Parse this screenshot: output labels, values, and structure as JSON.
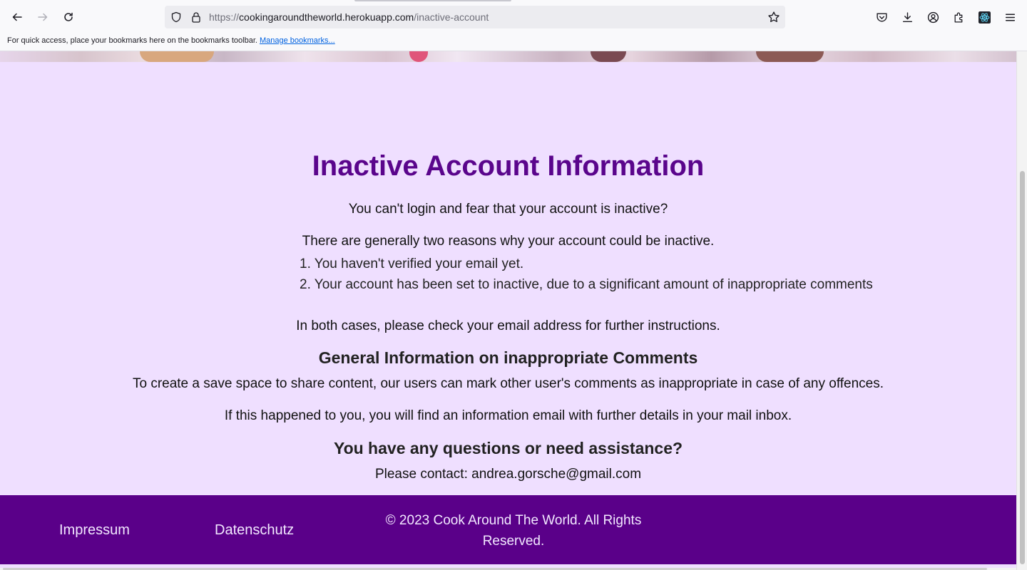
{
  "browser": {
    "url_scheme": "https://",
    "url_host": "cookingaroundtheworld.herokuapp.com",
    "url_path": "/inactive-account",
    "bookmarks_hint": "For quick access, place your bookmarks here on the bookmarks toolbar.",
    "manage_bookmarks": "Manage bookmarks..."
  },
  "page": {
    "title": "Inactive Account Information",
    "intro": "You can't login and fear that your account is inactive?",
    "reasons_intro": "There are generally two reasons why your account could be inactive.",
    "reasons": [
      "1. You haven't verified your email yet.",
      "2. Your account has been set to inactive, due to a significant amount of inappropriate comments"
    ],
    "check_email": "In both cases, please check your email address for further instructions.",
    "section_heading": "General Information on inappropriate Comments",
    "section_text": "To create a save space to share content, our users can mark other user's comments as inappropriate in case of any offences.",
    "section_text_2": "If this happened to you, you will find an information email with further details in your mail inbox.",
    "contact_heading": "You have any questions or need assistance?",
    "contact_text": "Please contact: andrea.gorsche@gmail.com"
  },
  "footer": {
    "impressum": "Impressum",
    "datenschutz": "Datenschutz",
    "copyright": "© 2023 Cook Around The World. All Rights Reserved."
  },
  "colors": {
    "page_background": "#efdfff",
    "title": "#5a058c",
    "footer_background": "#5a0089"
  },
  "icons": [
    "back-arrow-icon",
    "forward-arrow-icon",
    "reload-icon",
    "shield-icon",
    "lock-icon",
    "star-icon",
    "pocket-icon",
    "download-icon",
    "account-icon",
    "extensions-icon",
    "react-devtools-icon",
    "menu-icon"
  ]
}
